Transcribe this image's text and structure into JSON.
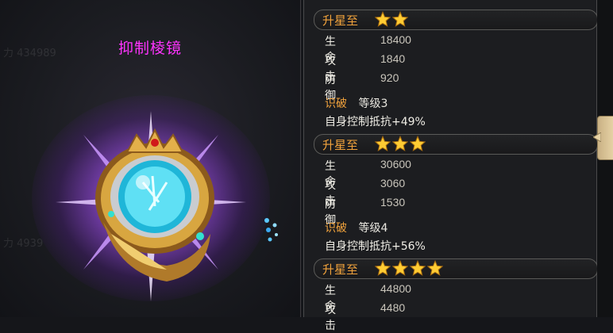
{
  "item": {
    "name": "抑制棱镜"
  },
  "tiers": [
    {
      "label": "升星至",
      "stars": 2,
      "stats": [
        {
          "name": "生命",
          "value": "18400"
        },
        {
          "name": "攻击",
          "value": "1840"
        },
        {
          "name": "防御",
          "value": "920"
        }
      ],
      "skill": {
        "name": "识破",
        "level": "等级3",
        "desc": "自身控制抵抗+49%"
      }
    },
    {
      "label": "升星至",
      "stars": 3,
      "stats": [
        {
          "name": "生命",
          "value": "30600"
        },
        {
          "name": "攻击",
          "value": "3060"
        },
        {
          "name": "防御",
          "value": "1530"
        }
      ],
      "skill": {
        "name": "识破",
        "level": "等级4",
        "desc": "自身控制抵抗+56%"
      }
    },
    {
      "label": "升星至",
      "stars": 4,
      "stats": [
        {
          "name": "生命",
          "value": "44800"
        },
        {
          "name": "攻击",
          "value": "4480"
        }
      ]
    }
  ],
  "colors": {
    "item_name": "#ff33ff",
    "tier_label": "#f2a33c",
    "skill_name": "#f2a33c",
    "star": "#ffcc33"
  },
  "icons": {
    "star": "star-icon",
    "collapse": "arrow-left-icon"
  }
}
